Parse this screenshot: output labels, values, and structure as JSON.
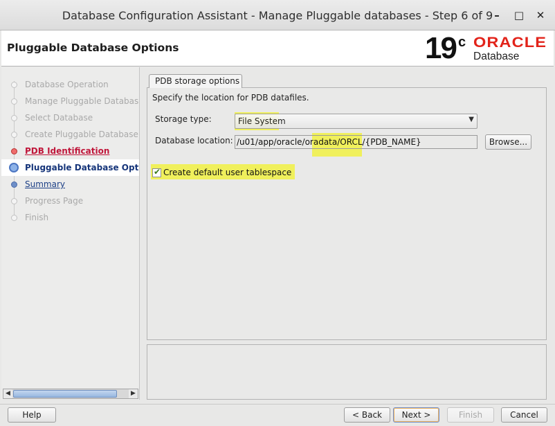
{
  "window": {
    "title": "Database Configuration Assistant - Manage Pluggable databases - Step 6 of 9",
    "minimize_glyph": "–",
    "maximize_glyph": "□",
    "close_glyph": "✕"
  },
  "header": {
    "page_title": "Pluggable Database Options",
    "logo_version": "19",
    "logo_version_sup": "c",
    "logo_brand": "ORACLE",
    "logo_product": "Database"
  },
  "nav": {
    "items": [
      {
        "label": "Database Operation",
        "state": "disabled"
      },
      {
        "label": "Manage Pluggable Databases",
        "state": "disabled"
      },
      {
        "label": "Select Database",
        "state": "disabled"
      },
      {
        "label": "Create Pluggable Database",
        "state": "disabled"
      },
      {
        "label": "PDB Identification",
        "state": "error"
      },
      {
        "label": "Pluggable Database Options",
        "state": "current"
      },
      {
        "label": "Summary",
        "state": "link"
      },
      {
        "label": "Progress Page",
        "state": "disabled"
      },
      {
        "label": "Finish",
        "state": "disabled"
      }
    ]
  },
  "main": {
    "tab_label": "PDB storage options",
    "instruction": "Specify the location for PDB datafiles.",
    "storage_type_label": "Storage type:",
    "storage_type_value": "File System",
    "database_location_label": "Database location:",
    "database_location_value": "/u01/app/oracle/oradata/ORCL/{PDB_NAME}",
    "browse_label": "Browse...",
    "create_tablespace_label": "Create default user tablespace",
    "create_tablespace_checked": true
  },
  "footer": {
    "help_label": "Help",
    "back_label": "< Back",
    "next_label": "Next >",
    "finish_label": "Finish",
    "cancel_label": "Cancel"
  },
  "colors": {
    "highlight": "#f2f22d",
    "oracle_red": "#e2231a",
    "nav_link": "#1c3f86",
    "nav_error": "#c0163a"
  }
}
